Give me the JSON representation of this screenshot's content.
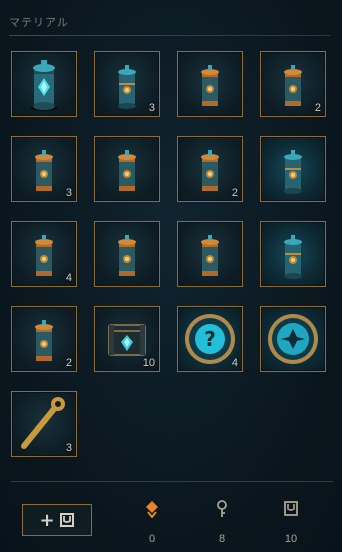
{
  "section": {
    "title": "マテリアル"
  },
  "items": [
    {
      "icon": "chest-capsule-large-icon",
      "count": ""
    },
    {
      "icon": "chest-capsule-icon",
      "count": "3"
    },
    {
      "icon": "orb-capsule-icon",
      "count": ""
    },
    {
      "icon": "orb-capsule-icon",
      "count": "2"
    },
    {
      "icon": "orb-capsule-icon",
      "count": "3"
    },
    {
      "icon": "orb-capsule-icon",
      "count": ""
    },
    {
      "icon": "orb-capsule-icon",
      "count": "2"
    },
    {
      "icon": "chest-capsule-icon",
      "count": ""
    },
    {
      "icon": "orb-capsule-icon",
      "count": "4"
    },
    {
      "icon": "orb-capsule-icon",
      "count": ""
    },
    {
      "icon": "orb-capsule-icon",
      "count": ""
    },
    {
      "icon": "chest-capsule-icon",
      "count": ""
    },
    {
      "icon": "orb-capsule-icon",
      "count": "2"
    },
    {
      "icon": "hextech-chest-icon",
      "count": "10"
    },
    {
      "icon": "mystery-token-icon",
      "count": "4"
    },
    {
      "icon": "emblem-token-icon",
      "count": ""
    },
    {
      "icon": "hextech-key-icon",
      "count": "3"
    }
  ],
  "footer": {
    "currencies": [
      {
        "icon": "orange-essence-icon",
        "value": "0"
      },
      {
        "icon": "key-fragment-icon",
        "value": "8"
      },
      {
        "icon": "chest-icon",
        "value": "10"
      }
    ]
  },
  "colors": {
    "gold_border": "#8a6d3b",
    "teal": "#2fd0e0",
    "orange": "#e8832a"
  }
}
